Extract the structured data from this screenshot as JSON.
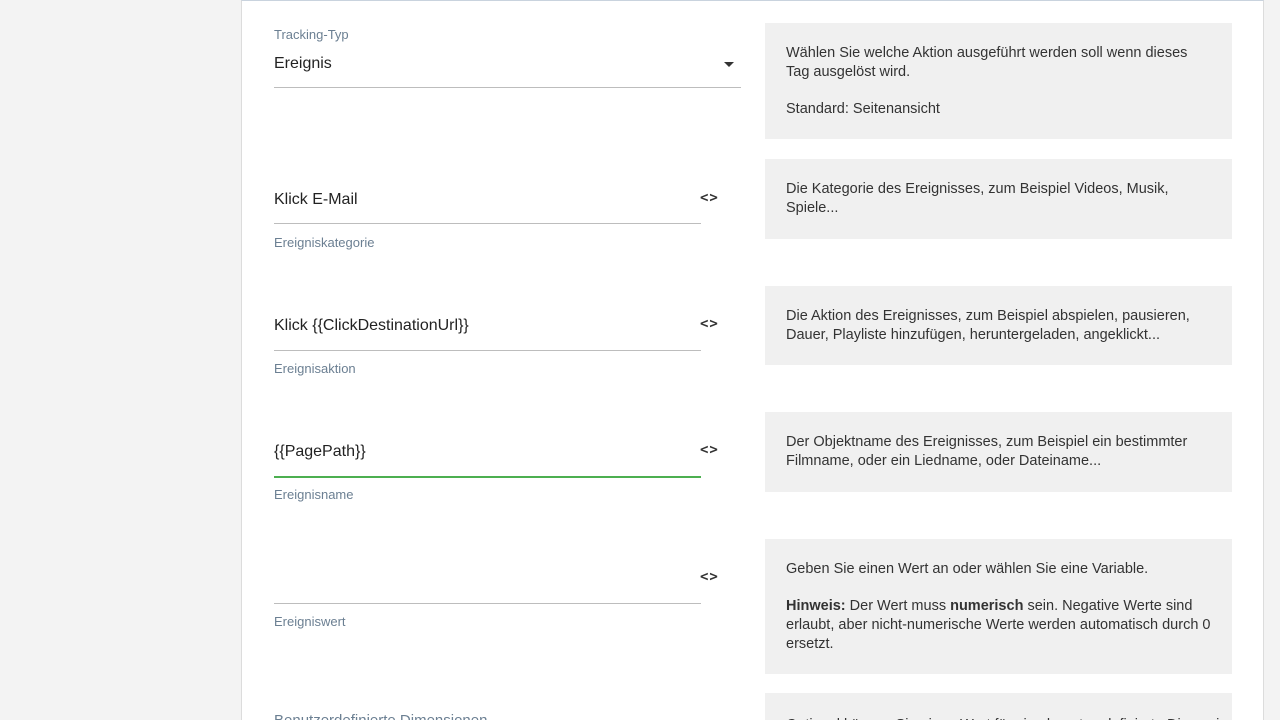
{
  "tracking_type": {
    "label": "Tracking-Typ",
    "value": "Ereignis",
    "help_line1": "Wählen Sie welche Aktion ausgeführt werden soll wenn dieses Tag ausgelöst wird.",
    "help_line2": "Standard: Seitenansicht"
  },
  "fields": [
    {
      "value": "Klick E-Mail",
      "helper": "Ereigniskategorie",
      "help": "Die Kategorie des Ereignisses, zum Beispiel Videos, Musik, Spiele..."
    },
    {
      "value": "Klick {{ClickDestinationUrl}}",
      "helper": "Ereignisaktion",
      "help": "Die Aktion des Ereignisses, zum Beispiel abspielen, pausieren, Dauer, Playliste hinzufügen, heruntergeladen, angeklickt..."
    },
    {
      "value": "{{PagePath}}",
      "helper": "Ereignisname",
      "help": "Der Objektname des Ereignisses, zum Beispiel ein bestimmter Filmname, oder ein Liedname, oder Dateiname..."
    },
    {
      "value": "",
      "helper": "Ereigniswert",
      "help_line1": "Geben Sie einen Wert an oder wählen Sie eine Variable.",
      "hint_label": "Hinweis:",
      "hint_text_a": " Der Wert muss ",
      "hint_bold": "numerisch",
      "hint_text_b": " sein. Negative Werte sind erlaubt, aber nicht-numerische Werte werden automatisch durch 0 ersetzt."
    }
  ],
  "code_icon_glyph": "<>",
  "custom_dimensions": {
    "label": "Benutzerdefinierte Dimensionen",
    "help": "Optional können Sie einen Wert für eine benutzerdefinierte Dimension angeben."
  }
}
